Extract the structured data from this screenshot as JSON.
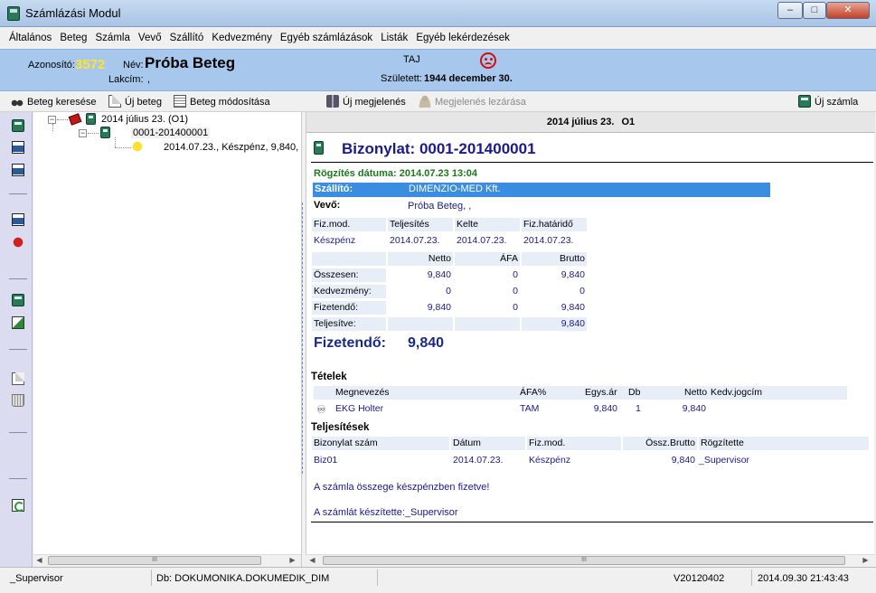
{
  "window": {
    "title": "Számlázási Modul",
    "minimize": "–",
    "maximize": "□",
    "close": "✕"
  },
  "menu": [
    "Általános",
    "Beteg",
    "Számla",
    "Vevő",
    "Szállító",
    "Kedvezmény",
    "Egyéb számlázások",
    "Listák",
    "Egyéb lekérdezések"
  ],
  "patient": {
    "id_label": "Azonosító:",
    "id_value": "3572",
    "name_label": "Név:",
    "name_value": "Próba Beteg",
    "address_label": "Lakcím:",
    "address_value": ",",
    "taj_label": "TAJ",
    "born_label": "Született:",
    "born_value": "1944 december 30."
  },
  "toolbar": {
    "search_patient": "Beteg keresése",
    "new_patient": "Új beteg",
    "edit_patient": "Beteg módosítása",
    "new_visit": "Új megjelenés",
    "close_visit": "Megjelenés lezárása",
    "new_invoice": "Új számla"
  },
  "tree": {
    "visit": "2014 július 23. (O1)",
    "invoice": "0001-201400001",
    "payment": "2014.07.23., Készpénz, 9,840,"
  },
  "document": {
    "header_date": "2014 július 23.",
    "header_code": "O1",
    "title": "Bizonylat: 0001-201400001",
    "recorded": "Rögzítés dátuma: 2014.07.23 13:04",
    "supplier_label": "Szállító:",
    "supplier_value": "DIMENZIO-MED Kft.",
    "buyer_label": "Vevő:",
    "buyer_value": "Próba Beteg,  ,",
    "payment_headers": [
      "Fiz.mod.",
      "Teljesítés",
      "Kelte",
      "Fiz.határidő"
    ],
    "payment_values": [
      "Készpénz",
      "2014.07.23.",
      "2014.07.23.",
      "2014.07.23."
    ],
    "amount_headers": [
      "Netto",
      "ÁFA",
      "Brutto"
    ],
    "amount_rows": [
      {
        "label": "Összesen:",
        "netto": "9,840",
        "afa": "0",
        "brutto": "9,840"
      },
      {
        "label": "Kedvezmény:",
        "netto": "0",
        "afa": "0",
        "brutto": "0"
      },
      {
        "label": "Fizetendő:",
        "netto": "9,840",
        "afa": "0",
        "brutto": "9,840"
      },
      {
        "label": "Teljesítve:",
        "netto": "",
        "afa": "",
        "brutto": "9,840"
      }
    ],
    "payable_label": "Fizetendő:",
    "payable_value": "9,840",
    "items_title": "Tételek",
    "items_headers": [
      "Megnevezés",
      "ÁFA%",
      "Egys.ár",
      "Db",
      "Netto",
      "Kedv.jogcím"
    ],
    "items": [
      {
        "name": "EKG Holter",
        "vat": "TAM",
        "unit_price": "9,840",
        "qty": "1",
        "netto": "9,840",
        "discount": ""
      }
    ],
    "payments_title": "Teljesítések",
    "payments_headers": [
      "Bizonylat szám",
      "Dátum",
      "Fiz.mod.",
      "Össz.Brutto",
      "Rögzítette"
    ],
    "payments": [
      {
        "doc": "Biz01",
        "date": "2014.07.23.",
        "method": "Készpénz",
        "gross": "9,840",
        "by": "_Supervisor"
      }
    ],
    "note_paid": "A számla összege készpénzben fizetve!",
    "note_author": "A számlát készítette:_Supervisor"
  },
  "status": {
    "user": "_Supervisor",
    "db": "Db: DOKUMONIKA.DOKUMEDIK_DIM",
    "version": "V20120402",
    "datetime": "2014.09.30 21:43:43"
  },
  "scroll": {
    "thumb": "III"
  },
  "colors": {
    "patient_bg": "#a7c7ec",
    "id_yellow": "#ffe42c",
    "supplier_bar": "#3a8de0",
    "doc_blue": "#1a1a8c",
    "recorded_green": "#1a7a1a"
  }
}
